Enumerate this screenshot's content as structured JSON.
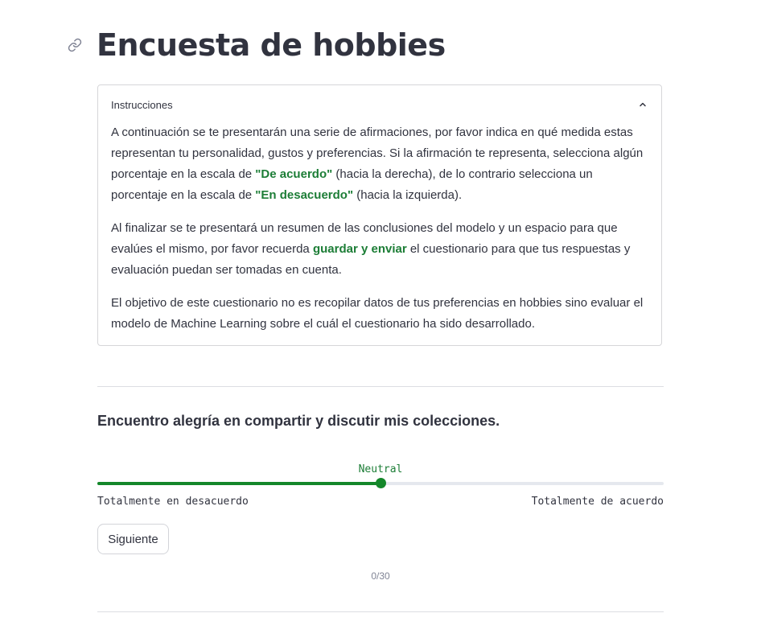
{
  "header": {
    "title": "Encuesta de hobbies",
    "link_icon": "link-icon"
  },
  "instructions": {
    "title": "Instrucciones",
    "expanded": true,
    "toggle_icon": "chevron-up-icon",
    "p1": {
      "t1": "A continuación se te presentarán una serie de afirmaciones, por favor indica en qué medida estas representan tu personalidad, gustos y preferencias. Si la afirmación te representa, selecciona algún porcentaje en la escala de ",
      "h1": "\"De acuerdo\"",
      "t2": " (hacia la derecha), de lo contrario selecciona un porcentaje en la escala de ",
      "h2": "\"En desacuerdo\"",
      "t3": " (hacia la izquierda)."
    },
    "p2": {
      "t1": "Al finalizar se te presentará un resumen de las conclusiones del modelo y un espacio para que evalúes el mismo, por favor recuerda ",
      "h1": "guardar y enviar",
      "t2": " el cuestionario para que tus respuestas y evaluación puedan ser tomadas en cuenta."
    },
    "p3": "El objetivo de este cuestionario no es recopilar datos de tus preferencias en hobbies sino evaluar el modelo de Machine Learning sobre el cuál el cuestionario ha sido desarrollado."
  },
  "question": {
    "text": "Encuentro alegría en compartir y discutir mis colecciones."
  },
  "slider": {
    "current_label": "Neutral",
    "min_label": "Totalmente en desacuerdo",
    "max_label": "Totalmente de acuerdo",
    "value_fraction": 0.5
  },
  "next_button": {
    "label": "Siguiente"
  },
  "progress": {
    "text": "0/30"
  },
  "colors": {
    "accent": "#14872a",
    "highlight_text": "#1c7d36",
    "text": "#31333f",
    "muted": "#808495"
  }
}
